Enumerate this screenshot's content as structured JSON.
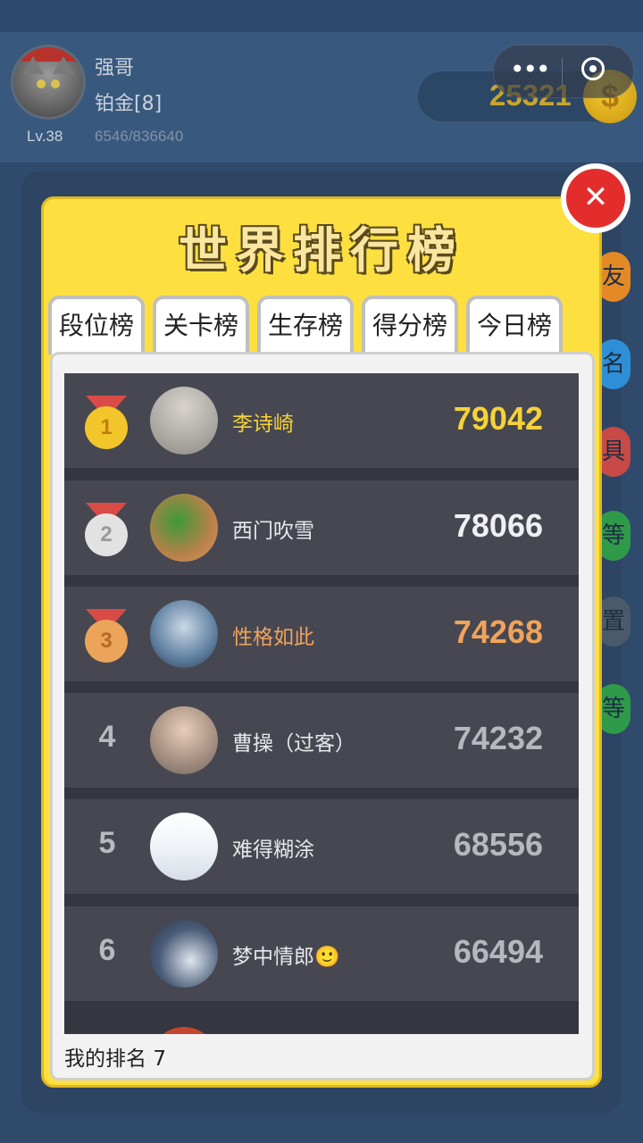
{
  "user": {
    "name": "强哥",
    "tier": "铂金[8]",
    "level": "Lv.38",
    "exp": "6546/836640",
    "coins": "25321",
    "coin_symbol": "$"
  },
  "capsule": {
    "more": "•••"
  },
  "side_buttons": [
    "友",
    "名",
    "具",
    "等",
    "置",
    "等"
  ],
  "panel": {
    "title": "世界排行榜",
    "close": "✕",
    "tabs": [
      {
        "label": "段位榜",
        "active": false
      },
      {
        "label": "关卡榜",
        "active": false
      },
      {
        "label": "生存榜",
        "active": false
      },
      {
        "label": "得分榜",
        "active": true
      },
      {
        "label": "今日榜",
        "active": false
      }
    ],
    "rows": [
      {
        "rank": "1",
        "name": "李诗崎",
        "score": "79042"
      },
      {
        "rank": "2",
        "name": "西门吹雪",
        "score": "78066"
      },
      {
        "rank": "3",
        "name": "性格如此",
        "score": "74268"
      },
      {
        "rank": "4",
        "name": "曹操（过客）",
        "score": "74232"
      },
      {
        "rank": "5",
        "name": "难得糊涂",
        "score": "68556"
      },
      {
        "rank": "6",
        "name": "梦中情郎🙂",
        "score": "66494"
      }
    ],
    "my_rank_label": "我的排名",
    "my_rank": "7"
  },
  "colors": {
    "gold": "#f5d239",
    "silver": "#d9d9d9",
    "bronze": "#f0a35a",
    "accent_yellow": "#fde03f",
    "close_red": "#e32d2d"
  }
}
